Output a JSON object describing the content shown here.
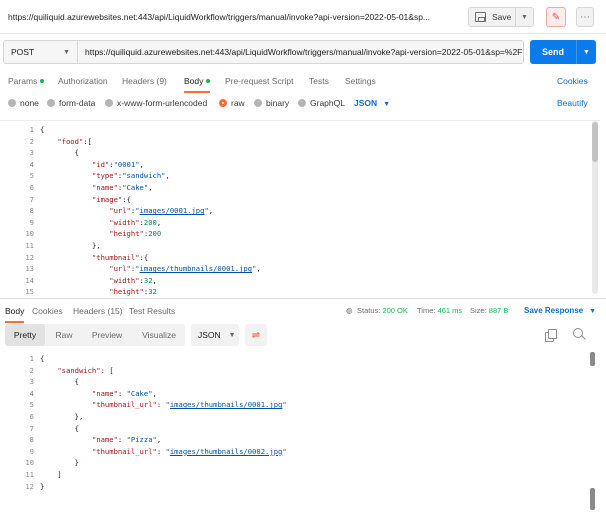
{
  "titlebar": {
    "url_title": "https://quiliquid.azurewebsites.net:443/api/LiquidWorkflow/triggers/manual/invoke?api-version=2022-05-01&sp...",
    "save_label": "Save"
  },
  "request": {
    "method": "POST",
    "url": "https://quiliquid.azurewebsites.net:443/api/LiquidWorkflow/triggers/manual/invoke?api-version=2022-05-01&sp=%2F",
    "send_label": "Send"
  },
  "request_tabs": {
    "params": "Params",
    "authorization": "Authorization",
    "headers": "Headers (9)",
    "body": "Body",
    "prerequest": "Pre-request Script",
    "tests": "Tests",
    "settings": "Settings",
    "cookies": "Cookies"
  },
  "body_types": {
    "none": "none",
    "form_data": "form-data",
    "urlencoded": "x-www-form-urlencoded",
    "raw": "raw",
    "binary": "binary",
    "graphql": "GraphQL",
    "format": "JSON",
    "beautify": "Beautify"
  },
  "request_body": [
    {
      "n": "1",
      "t": "{"
    },
    {
      "n": "2",
      "t": "    \"food\":["
    },
    {
      "n": "3",
      "t": "        {"
    },
    {
      "n": "4",
      "t": "            \"id\":\"0001\","
    },
    {
      "n": "5",
      "t": "            \"type\":\"sandwich\","
    },
    {
      "n": "6",
      "t": "            \"name\":\"Cake\","
    },
    {
      "n": "7",
      "t": "            \"image\":{"
    },
    {
      "n": "8",
      "t": "                \"url\":\"images/0001.jpg\","
    },
    {
      "n": "9",
      "t": "                \"width\":200,"
    },
    {
      "n": "10",
      "t": "                \"height\":200"
    },
    {
      "n": "11",
      "t": "            },"
    },
    {
      "n": "12",
      "t": "            \"thumbnail\":{"
    },
    {
      "n": "13",
      "t": "                \"url\":\"images/thumbnails/0001.jpg\","
    },
    {
      "n": "14",
      "t": "                \"width\":32,"
    },
    {
      "n": "15",
      "t": "                \"height\":32"
    }
  ],
  "response_tabs": {
    "body": "Body",
    "cookies": "Cookies",
    "headers": "Headers (15)",
    "test_results": "Test Results",
    "status_label": "Status:",
    "status_value": "200 OK",
    "time_label": "Time:",
    "time_value": "461 ms",
    "size_label": "Size:",
    "size_value": "887 B",
    "save_response": "Save Response"
  },
  "response_toolbar": {
    "pretty": "Pretty",
    "raw": "Raw",
    "preview": "Preview",
    "visualize": "Visualize",
    "format": "JSON"
  },
  "response_body": [
    {
      "n": "1",
      "t": "{"
    },
    {
      "n": "2",
      "t": "    \"sandwich\": ["
    },
    {
      "n": "3",
      "t": "        {"
    },
    {
      "n": "4",
      "t": "            \"name\": \"Cake\","
    },
    {
      "n": "5",
      "t": "            \"thumbnail_url\": \"images/thumbnails/0001.jpg\""
    },
    {
      "n": "6",
      "t": "        },"
    },
    {
      "n": "7",
      "t": "        {"
    },
    {
      "n": "8",
      "t": "            \"name\": \"Pizza\","
    },
    {
      "n": "9",
      "t": "            \"thumbnail_url\": \"images/thumbnails/0002.jpg\""
    },
    {
      "n": "10",
      "t": "        }"
    },
    {
      "n": "11",
      "t": "    ]"
    },
    {
      "n": "12",
      "t": "}"
    }
  ],
  "colors": {
    "accent": "#ff6c37",
    "send": "#097bed",
    "link": "#0b6dd6",
    "status_ok": "#0cbb52"
  }
}
